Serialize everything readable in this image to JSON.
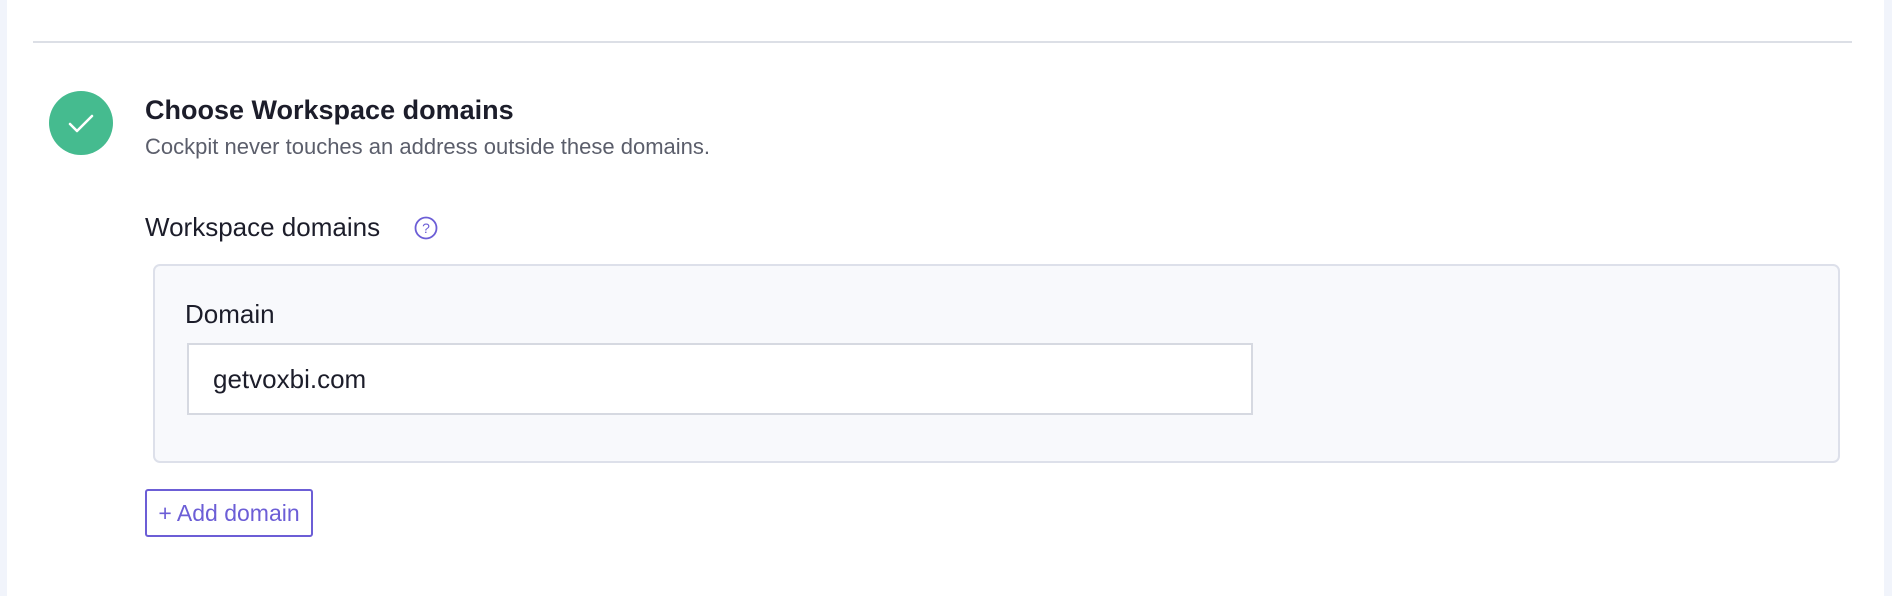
{
  "step": {
    "status": "completed",
    "status_icon": "check-icon",
    "status_color": "#45bb8f",
    "title": "Choose Workspace domains",
    "subtitle": "Cockpit never touches an address outside these domains."
  },
  "domains_field": {
    "label": "Workspace domains",
    "help_icon": "question-circle-icon",
    "entries": [
      {
        "label": "Domain",
        "value": "getvoxbi.com"
      }
    ],
    "add_button_label": "+ Add domain"
  },
  "colors": {
    "accent": "#6c5ed6",
    "success": "#45bb8f",
    "text": "#1c1d2a",
    "muted_text": "#5b5e6b"
  }
}
